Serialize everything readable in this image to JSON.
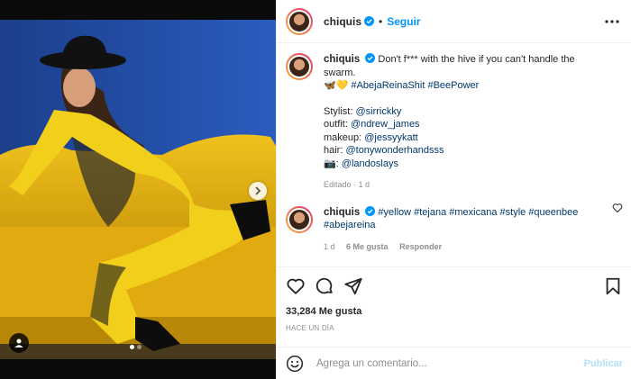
{
  "post": {
    "username": "chiquis",
    "follow_label": "Seguir",
    "separator": "•"
  },
  "caption": {
    "username": "chiquis",
    "line1": "Don't f*** with the hive if you can't handle the swarm.",
    "emojis": "🦋💛",
    "hashtags": "#AbejaReinaShit #BeePower",
    "credits": [
      {
        "label": "Stylist: ",
        "handle": "@sirrickky"
      },
      {
        "label": "outfit: ",
        "handle": "@ndrew_james"
      },
      {
        "label": "makeup: ",
        "handle": "@jessyykatt"
      },
      {
        "label": "hair: ",
        "handle": "@tonywonderhandsss"
      },
      {
        "label": "📷: ",
        "handle": "@landoslays"
      }
    ],
    "edited": "Editado · 1 d"
  },
  "reply": {
    "username": "chiquis",
    "tags_line1": "#yellow #tejana #mexicana #style #queenbee",
    "tags_line2": "#abejareina",
    "age": "1 d",
    "likes": "6 Me gusta",
    "reply_label": "Responder"
  },
  "engagement": {
    "likes": "33,284 Me gusta",
    "posted": "HACE UN DÍA"
  },
  "comment_box": {
    "placeholder": "Agrega un comentario...",
    "publish_label": "Publicar"
  },
  "icons": {
    "verified": "verified-badge-icon",
    "more": "more-options-icon",
    "like": "heart-icon",
    "comment": "comment-icon",
    "share": "send-icon",
    "save": "bookmark-icon",
    "emoji": "emoji-icon",
    "next": "chevron-right-icon",
    "tags": "user-tag-icon"
  },
  "colors": {
    "accent_blue": "#0095f6",
    "hashtag": "#00376b",
    "muted": "#8e8e8e"
  },
  "carousel": {
    "slides": 2,
    "active": 1
  }
}
